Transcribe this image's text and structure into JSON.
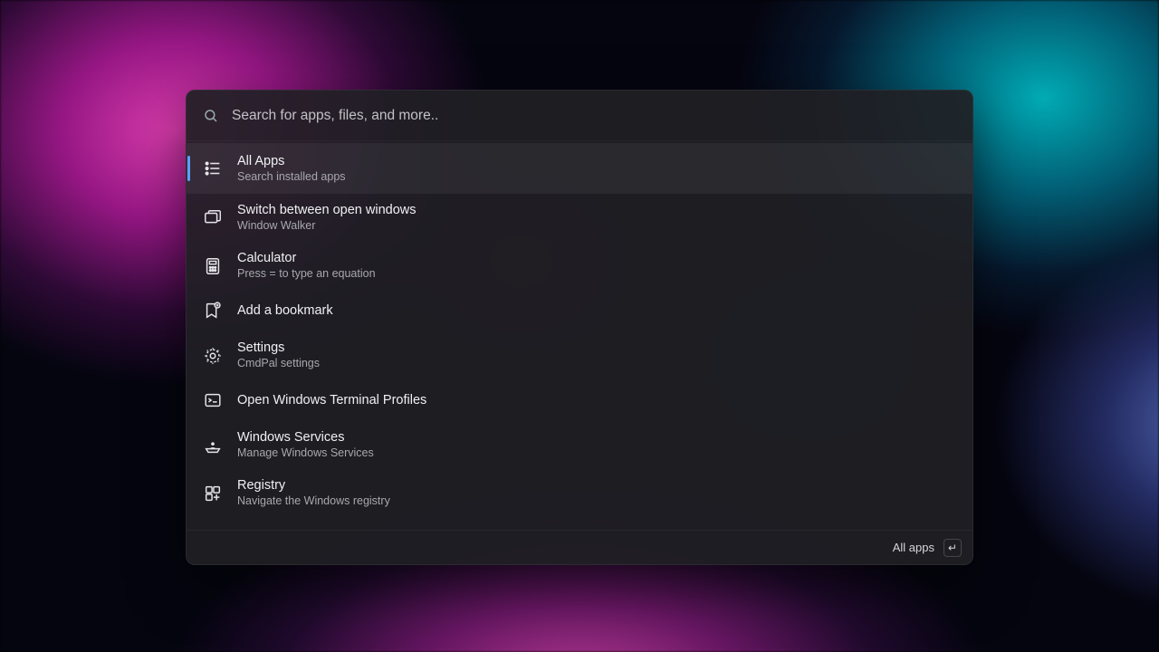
{
  "search": {
    "placeholder": "Search for apps, files, and more.."
  },
  "items": [
    {
      "title": "All Apps",
      "sub": "Search installed apps"
    },
    {
      "title": "Switch between open windows",
      "sub": "Window Walker"
    },
    {
      "title": "Calculator",
      "sub": "Press = to type an equation"
    },
    {
      "title": "Add a bookmark",
      "sub": ""
    },
    {
      "title": "Settings",
      "sub": "CmdPal settings"
    },
    {
      "title": "Open Windows Terminal Profiles",
      "sub": ""
    },
    {
      "title": "Windows Services",
      "sub": "Manage Windows Services"
    },
    {
      "title": "Registry",
      "sub": "Navigate the Windows registry"
    }
  ],
  "footer": {
    "action_label": "All apps",
    "key_glyph": "↵"
  }
}
